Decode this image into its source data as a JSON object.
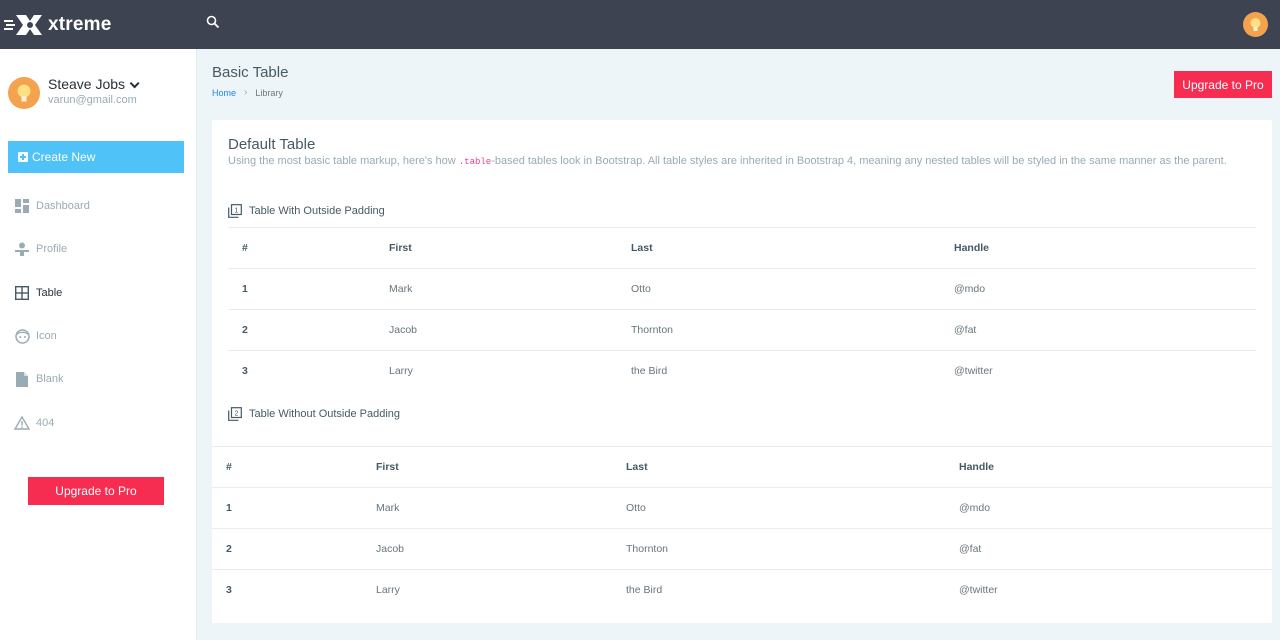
{
  "brand": {
    "name": "xtreme"
  },
  "topbar": {
    "search_icon": "search-icon"
  },
  "sidebar": {
    "user": {
      "name": "Steave Jobs",
      "email": "varun@gmail.com"
    },
    "create_label": "Create New",
    "items": [
      {
        "label": "Dashboard",
        "icon": "dashboard-icon"
      },
      {
        "label": "Profile",
        "icon": "profile-icon"
      },
      {
        "label": "Table",
        "icon": "table-icon",
        "active": true
      },
      {
        "label": "Icon",
        "icon": "face-icon"
      },
      {
        "label": "Blank",
        "icon": "file-icon"
      },
      {
        "label": "404",
        "icon": "warning-icon"
      }
    ],
    "upgrade_label": "Upgrade to Pro"
  },
  "page": {
    "title": "Basic Table",
    "breadcrumb": {
      "home": "Home",
      "current": "Library"
    },
    "upgrade_label": "Upgrade to Pro"
  },
  "card": {
    "title": "Default Table",
    "subtitle_pre": "Using the most basic table markup, here's how ",
    "subtitle_code": ".table",
    "subtitle_post": "-based tables look in Bootstrap. All table styles are inherited in Bootstrap 4, meaning any nested tables will be styled in the same manner as the parent.",
    "section1": "Table With Outside Padding",
    "section2": "Table Without Outside Padding",
    "columns": [
      "#",
      "First",
      "Last",
      "Handle"
    ],
    "rows": [
      [
        "1",
        "Mark",
        "Otto",
        "@mdo"
      ],
      [
        "2",
        "Jacob",
        "Thornton",
        "@fat"
      ],
      [
        "3",
        "Larry",
        "the Bird",
        "@twitter"
      ]
    ]
  },
  "colors": {
    "topbar": "#3e4351",
    "accent": "#4fc3f7",
    "danger": "#f62d51",
    "link": "#1e88e5"
  }
}
